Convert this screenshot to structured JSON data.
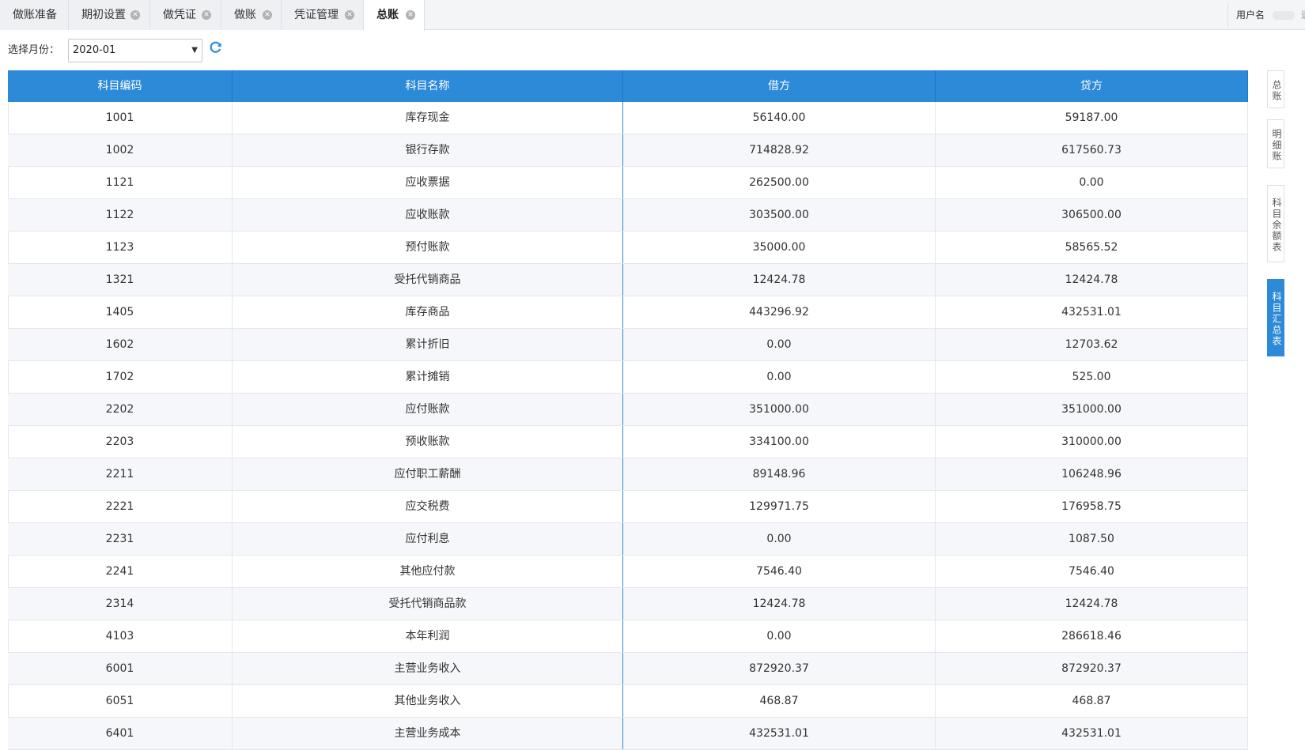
{
  "tabs": [
    {
      "label": "做账准备",
      "closable": false,
      "active": false
    },
    {
      "label": "期初设置",
      "closable": true,
      "active": false
    },
    {
      "label": "做凭证",
      "closable": true,
      "active": false
    },
    {
      "label": "做账",
      "closable": true,
      "active": false
    },
    {
      "label": "凭证管理",
      "closable": true,
      "active": false
    },
    {
      "label": "总账",
      "closable": true,
      "active": true
    }
  ],
  "user": {
    "label": "用户名",
    "more": "退"
  },
  "toolbar": {
    "month_label": "选择月份：",
    "month_value": "2020-01",
    "refresh_icon": "refresh-icon"
  },
  "table": {
    "headers": [
      "科目编码",
      "科目名称",
      "借方",
      "贷方"
    ],
    "rows": [
      [
        "1001",
        "库存现金",
        "56140.00",
        "59187.00"
      ],
      [
        "1002",
        "银行存款",
        "714828.92",
        "617560.73"
      ],
      [
        "1121",
        "应收票据",
        "262500.00",
        "0.00"
      ],
      [
        "1122",
        "应收账款",
        "303500.00",
        "306500.00"
      ],
      [
        "1123",
        "预付账款",
        "35000.00",
        "58565.52"
      ],
      [
        "1321",
        "受托代销商品",
        "12424.78",
        "12424.78"
      ],
      [
        "1405",
        "库存商品",
        "443296.92",
        "432531.01"
      ],
      [
        "1602",
        "累计折旧",
        "0.00",
        "12703.62"
      ],
      [
        "1702",
        "累计摊销",
        "0.00",
        "525.00"
      ],
      [
        "2202",
        "应付账款",
        "351000.00",
        "351000.00"
      ],
      [
        "2203",
        "预收账款",
        "334100.00",
        "310000.00"
      ],
      [
        "2211",
        "应付职工薪酬",
        "89148.96",
        "106248.96"
      ],
      [
        "2221",
        "应交税费",
        "129971.75",
        "176958.75"
      ],
      [
        "2231",
        "应付利息",
        "0.00",
        "1087.50"
      ],
      [
        "2241",
        "其他应付款",
        "7546.40",
        "7546.40"
      ],
      [
        "2314",
        "受托代销商品款",
        "12424.78",
        "12424.78"
      ],
      [
        "4103",
        "本年利润",
        "0.00",
        "286618.46"
      ],
      [
        "6001",
        "主营业务收入",
        "872920.37",
        "872920.37"
      ],
      [
        "6051",
        "其他业务收入",
        "468.87",
        "468.87"
      ],
      [
        "6401",
        "主营业务成本",
        "432531.01",
        "432531.01"
      ]
    ]
  },
  "side_nav": [
    {
      "label": "总账",
      "active": false
    },
    {
      "label": "明细账",
      "active": false
    },
    {
      "label": "科目余额表",
      "active": false
    },
    {
      "label": "科目汇总表",
      "active": true
    }
  ],
  "colors": {
    "accent": "#2d8ad9",
    "close_icon": "#b3b3b3"
  }
}
